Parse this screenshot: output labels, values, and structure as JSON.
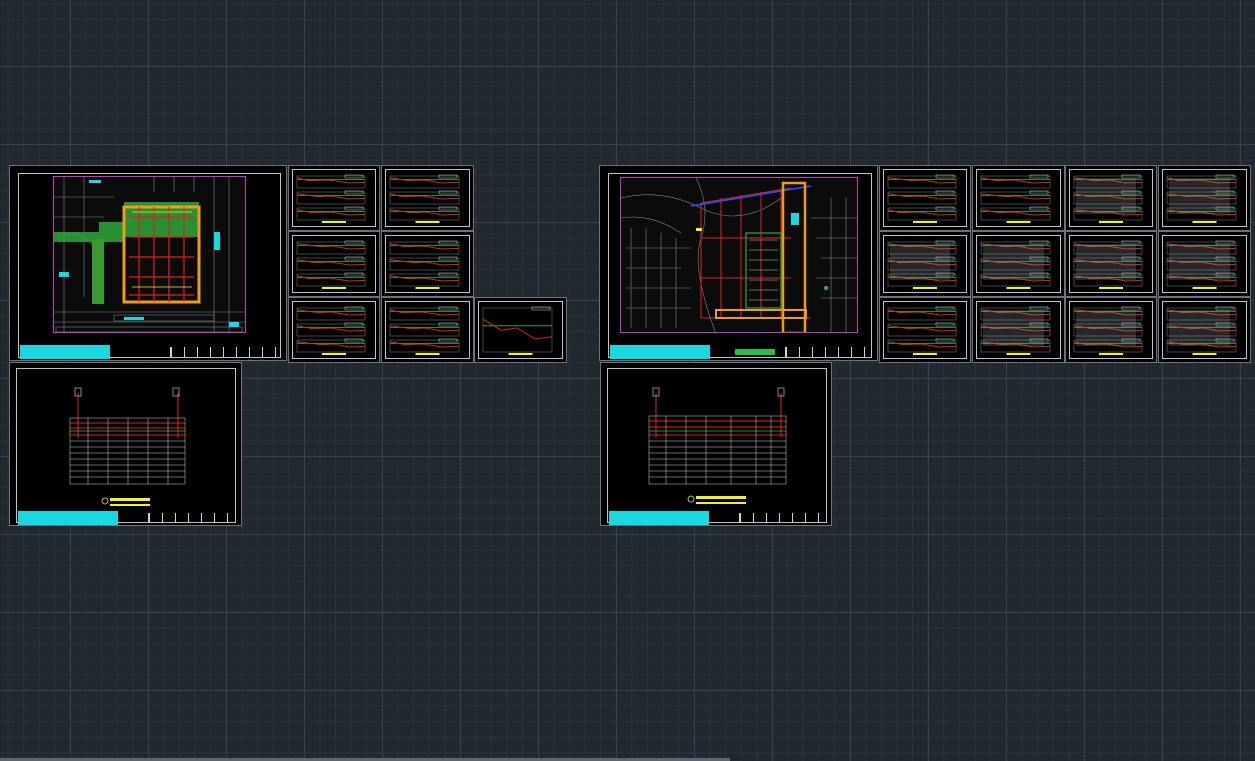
{
  "canvas": {
    "background": "#212830",
    "grid_color": "#465260"
  },
  "colors": {
    "title_block": "#19d8e0",
    "boundary": "#c13cc0",
    "route_red": "#e02020",
    "route_green": "#28c040",
    "route_orange": "#f0a020",
    "yellow": "#f0f030",
    "road_grey": "#808890"
  },
  "layouts": [
    {
      "name": "left-group",
      "main_sheet": "site-plan-1",
      "thumbnail_count": 7,
      "table_sheet": "schedule-1"
    },
    {
      "name": "right-group",
      "main_sheet": "site-plan-2",
      "thumbnail_count": 12,
      "table_sheet": "schedule-2"
    }
  ]
}
